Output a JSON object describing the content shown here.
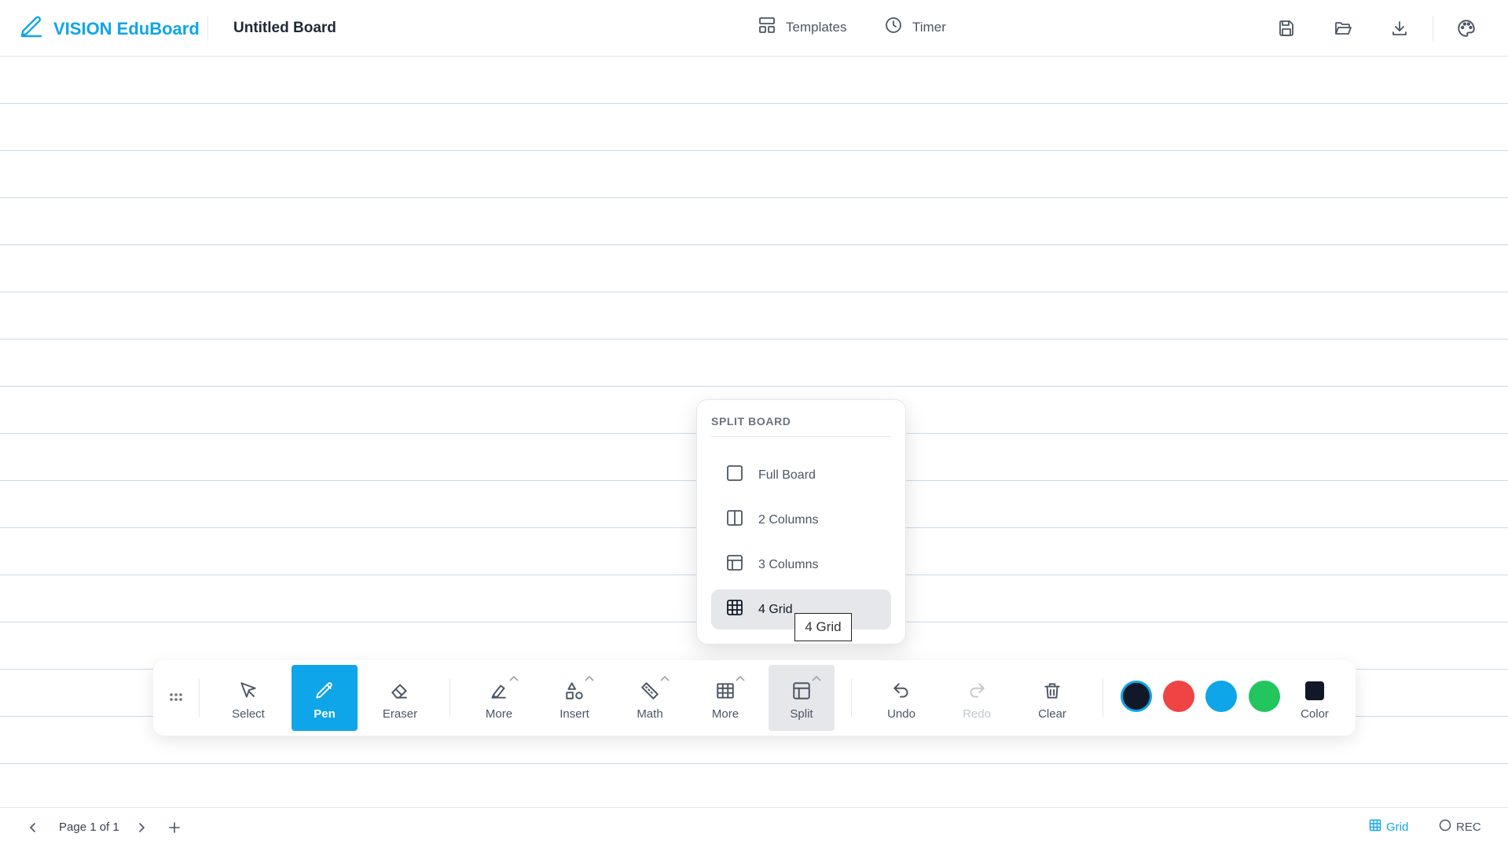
{
  "app": {
    "brand": "VISION EduBoard",
    "board_title": "Untitled Board",
    "accent_color": "#0ea5e9"
  },
  "header": {
    "templates_label": "Templates",
    "timer_label": "Timer",
    "icons": [
      "save-icon",
      "folder-open-icon",
      "download-icon",
      "palette-icon"
    ]
  },
  "split_menu": {
    "title": "SPLIT BOARD",
    "items": [
      {
        "label": "Full Board",
        "icon": "full-board-icon",
        "selected": false
      },
      {
        "label": "2 Columns",
        "icon": "two-columns-icon",
        "selected": false
      },
      {
        "label": "3 Columns",
        "icon": "three-columns-icon",
        "selected": false
      },
      {
        "label": "4 Grid",
        "icon": "four-grid-icon",
        "selected": true
      }
    ],
    "tooltip": "4 Grid"
  },
  "toolbar": {
    "tools": [
      {
        "label": "Select",
        "icon": "cursor-icon",
        "state": "normal"
      },
      {
        "label": "Pen",
        "icon": "pen-icon",
        "state": "active"
      },
      {
        "label": "Eraser",
        "icon": "eraser-icon",
        "state": "normal"
      },
      {
        "label": "More",
        "icon": "highlighter-icon",
        "state": "normal",
        "has_menu": true
      },
      {
        "label": "Insert",
        "icon": "shapes-icon",
        "state": "normal",
        "has_menu": true
      },
      {
        "label": "Math",
        "icon": "ruler-icon",
        "state": "normal",
        "has_menu": true
      },
      {
        "label": "More",
        "icon": "table-icon",
        "state": "normal",
        "has_menu": true
      },
      {
        "label": "Split",
        "icon": "split-icon",
        "state": "hover",
        "has_menu": true
      },
      {
        "label": "Undo",
        "icon": "undo-icon",
        "state": "normal"
      },
      {
        "label": "Redo",
        "icon": "redo-icon",
        "state": "disabled"
      },
      {
        "label": "Clear",
        "icon": "trash-icon",
        "state": "normal"
      }
    ],
    "colors": [
      "#111827",
      "#ef4444",
      "#0ea5e9",
      "#22c55e"
    ],
    "selected_color": "#111827",
    "color_label": "Color"
  },
  "statusbar": {
    "page_info": "Page 1 of 1",
    "grid_label": "Grid",
    "rec_label": "REC"
  }
}
